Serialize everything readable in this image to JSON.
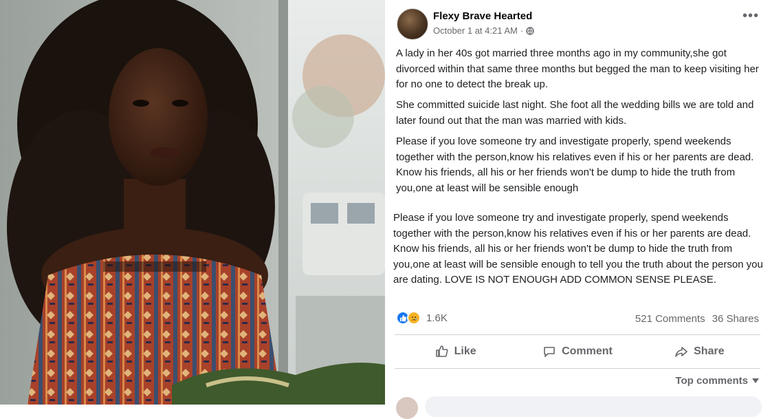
{
  "post": {
    "author": "Flexy Brave Hearted",
    "timestamp": "October 1 at 4:21 AM",
    "timestamp_separator": "·",
    "privacy_icon": "globe-icon",
    "more_icon": "more-options-icon",
    "paragraphs": [
      "A  lady in her 40s got married three months ago in my community,she got divorced within that same three months but begged the man to keep visiting her for no one to detect the break up.",
      "She committed suicide last night. She foot all the wedding bills we are told and later found out that the man was married with kids.",
      "Please if you love someone try and investigate properly, spend weekends together with the person,know his relatives even if his or her parents are dead. Know his friends, all his or her friends won't be dump to hide the truth from you,one at least will be sensible enough",
      "Please if you love someone try and investigate properly, spend weekends together with the person,know his relatives even if his or her parents are dead. Know his friends, all his or her friends won't be dump to hide the truth from you,one at least will be sensible enough to tell you the truth about the person you are dating.  LOVE IS NOT ENOUGH ADD COMMON SENSE PLEASE."
    ],
    "reactions": {
      "icons": [
        "like-icon",
        "sad-icon"
      ],
      "count": "1.6K"
    },
    "comments_count": "521 Comments",
    "shares_count": "36 Shares",
    "actions": {
      "like": "Like",
      "comment": "Comment",
      "share": "Share"
    },
    "top_comments": "Top comments"
  },
  "colors": {
    "link_blue": "#1877f2",
    "sad_yellow": "#f7b125",
    "secondary_text": "#65676b",
    "divider": "#ced0d4"
  }
}
